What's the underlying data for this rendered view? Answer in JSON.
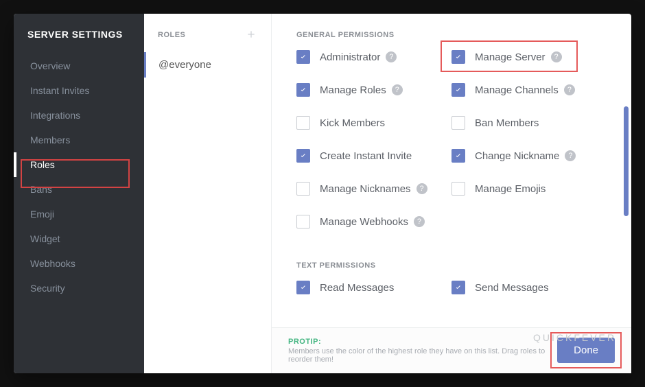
{
  "sidebar": {
    "title": "SERVER SETTINGS",
    "items": [
      {
        "label": "Overview",
        "active": false
      },
      {
        "label": "Instant Invites",
        "active": false
      },
      {
        "label": "Integrations",
        "active": false
      },
      {
        "label": "Members",
        "active": false
      },
      {
        "label": "Roles",
        "active": true
      },
      {
        "label": "Bans",
        "active": false
      },
      {
        "label": "Emoji",
        "active": false
      },
      {
        "label": "Widget",
        "active": false
      },
      {
        "label": "Webhooks",
        "active": false
      },
      {
        "label": "Security",
        "active": false
      }
    ]
  },
  "roleList": {
    "header": "ROLES",
    "items": [
      {
        "label": "@everyone",
        "selected": true
      }
    ]
  },
  "permissions": {
    "sections": [
      {
        "title": "GENERAL PERMISSIONS",
        "items": [
          {
            "label": "Administrator",
            "checked": true,
            "help": true,
            "highlight": false
          },
          {
            "label": "Manage Server",
            "checked": true,
            "help": true,
            "highlight": true
          },
          {
            "label": "Manage Roles",
            "checked": true,
            "help": true,
            "highlight": false
          },
          {
            "label": "Manage Channels",
            "checked": true,
            "help": true,
            "highlight": false
          },
          {
            "label": "Kick Members",
            "checked": false,
            "help": false,
            "highlight": false
          },
          {
            "label": "Ban Members",
            "checked": false,
            "help": false,
            "highlight": false
          },
          {
            "label": "Create Instant Invite",
            "checked": true,
            "help": false,
            "highlight": false
          },
          {
            "label": "Change Nickname",
            "checked": true,
            "help": true,
            "highlight": false
          },
          {
            "label": "Manage Nicknames",
            "checked": false,
            "help": true,
            "highlight": false
          },
          {
            "label": "Manage Emojis",
            "checked": false,
            "help": false,
            "highlight": false
          },
          {
            "label": "Manage Webhooks",
            "checked": false,
            "help": true,
            "highlight": false
          }
        ]
      },
      {
        "title": "TEXT PERMISSIONS",
        "items": [
          {
            "label": "Read Messages",
            "checked": true,
            "help": false,
            "highlight": false
          },
          {
            "label": "Send Messages",
            "checked": true,
            "help": false,
            "highlight": false
          }
        ]
      }
    ]
  },
  "footer": {
    "protip_label": "PROTIP:",
    "protip_text": "Members use the color of the highest role they have on this list. Drag roles to reorder them!",
    "done_label": "Done"
  },
  "watermark": "QUICKFEVER",
  "accent": "#697ec4",
  "highlight_color": "#e55a5a"
}
